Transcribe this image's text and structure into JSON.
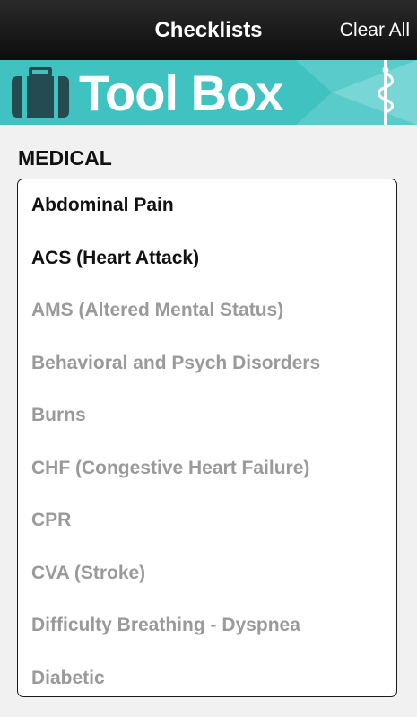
{
  "header": {
    "title": "Checklists",
    "clear_all_label": "Clear All"
  },
  "banner": {
    "brand": "Tool Box",
    "icon": "briefcase-icon",
    "emblem": "caduceus-staff-icon",
    "background_color": "#3fc2c0"
  },
  "section": {
    "heading": "MEDICAL"
  },
  "checklists": [
    {
      "label": "Abdominal Pain",
      "active": true
    },
    {
      "label": "ACS (Heart Attack)",
      "active": true
    },
    {
      "label": "AMS (Altered Mental Status)",
      "active": false
    },
    {
      "label": "Behavioral and Psych Disorders",
      "active": false
    },
    {
      "label": "Burns",
      "active": false
    },
    {
      "label": "CHF (Congestive Heart Failure)",
      "active": false
    },
    {
      "label": "CPR",
      "active": false
    },
    {
      "label": "CVA (Stroke)",
      "active": false
    },
    {
      "label": "Difficulty Breathing - Dyspnea",
      "active": false
    },
    {
      "label": "Diabetic",
      "active": false
    }
  ],
  "colors": {
    "active_text": "#111111",
    "inactive_text": "#9a9a9a",
    "top_bar": "#1a1a1a"
  }
}
